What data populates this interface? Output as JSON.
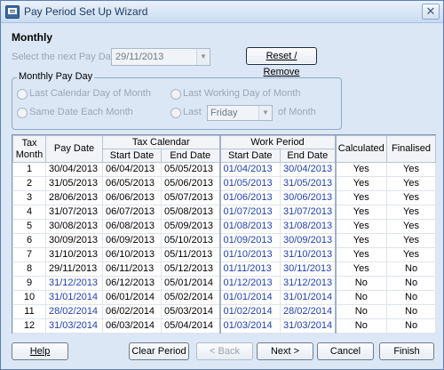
{
  "window": {
    "title": "Pay Period Set Up Wizard",
    "close_glyph": "✕"
  },
  "heading": "Monthly",
  "next_pay_date": {
    "label": "Select the next Pay Date",
    "value": "29/11/2013"
  },
  "reset_button": "Reset / Remove",
  "monthly_pay_day": {
    "title": "Monthly Pay Day",
    "opt_last_calendar": "Last Calendar Day of Month",
    "opt_last_working": "Last Working Day of Month",
    "opt_same_date": "Same Date Each Month",
    "opt_last": "Last",
    "day_value": "Friday",
    "of_month": "of Month"
  },
  "table": {
    "headers": {
      "tax_month": "Tax\nMonth",
      "pay_date": "Pay Date",
      "tax_calendar": "Tax Calendar",
      "start_date": "Start Date",
      "end_date": "End Date",
      "work_period": "Work Period",
      "calculated": "Calculated",
      "finalised": "Finalised"
    },
    "rows": [
      {
        "m": "1",
        "pay": "30/04/2013",
        "ts": "06/04/2013",
        "te": "05/05/2013",
        "ws": "01/04/2013",
        "we": "30/04/2013",
        "calc": "Yes",
        "fin": "Yes"
      },
      {
        "m": "2",
        "pay": "31/05/2013",
        "ts": "06/05/2013",
        "te": "05/06/2013",
        "ws": "01/05/2013",
        "we": "31/05/2013",
        "calc": "Yes",
        "fin": "Yes"
      },
      {
        "m": "3",
        "pay": "28/06/2013",
        "ts": "06/06/2013",
        "te": "05/07/2013",
        "ws": "01/06/2013",
        "we": "30/06/2013",
        "calc": "Yes",
        "fin": "Yes"
      },
      {
        "m": "4",
        "pay": "31/07/2013",
        "ts": "06/07/2013",
        "te": "05/08/2013",
        "ws": "01/07/2013",
        "we": "31/07/2013",
        "calc": "Yes",
        "fin": "Yes"
      },
      {
        "m": "5",
        "pay": "30/08/2013",
        "ts": "06/08/2013",
        "te": "05/09/2013",
        "ws": "01/08/2013",
        "we": "31/08/2013",
        "calc": "Yes",
        "fin": "Yes"
      },
      {
        "m": "6",
        "pay": "30/09/2013",
        "ts": "06/09/2013",
        "te": "05/10/2013",
        "ws": "01/09/2013",
        "we": "30/09/2013",
        "calc": "Yes",
        "fin": "Yes"
      },
      {
        "m": "7",
        "pay": "31/10/2013",
        "ts": "06/10/2013",
        "te": "05/11/2013",
        "ws": "01/10/2013",
        "we": "31/10/2013",
        "calc": "Yes",
        "fin": "Yes"
      },
      {
        "m": "8",
        "pay": "29/11/2013",
        "ts": "06/11/2013",
        "te": "05/12/2013",
        "ws": "01/11/2013",
        "we": "30/11/2013",
        "calc": "Yes",
        "fin": "No"
      },
      {
        "m": "9",
        "pay": "31/12/2013",
        "ts": "06/12/2013",
        "te": "05/01/2014",
        "ws": "01/12/2013",
        "we": "31/12/2013",
        "calc": "No",
        "fin": "No"
      },
      {
        "m": "10",
        "pay": "31/01/2014",
        "ts": "06/01/2014",
        "te": "05/02/2014",
        "ws": "01/01/2014",
        "we": "31/01/2014",
        "calc": "No",
        "fin": "No"
      },
      {
        "m": "11",
        "pay": "28/02/2014",
        "ts": "06/02/2014",
        "te": "05/03/2014",
        "ws": "01/02/2014",
        "we": "28/02/2014",
        "calc": "No",
        "fin": "No"
      },
      {
        "m": "12",
        "pay": "31/03/2014",
        "ts": "06/03/2014",
        "te": "05/04/2014",
        "ws": "01/03/2014",
        "we": "31/03/2014",
        "calc": "No",
        "fin": "No"
      }
    ]
  },
  "footer": {
    "help": "Help",
    "clear_period": "Clear Period",
    "back": "< Back",
    "next": "Next >",
    "cancel": "Cancel",
    "finish": "Finish"
  },
  "colors": {
    "editable_date": "#1f3fb3",
    "window_bg": "#dbe7f5"
  }
}
